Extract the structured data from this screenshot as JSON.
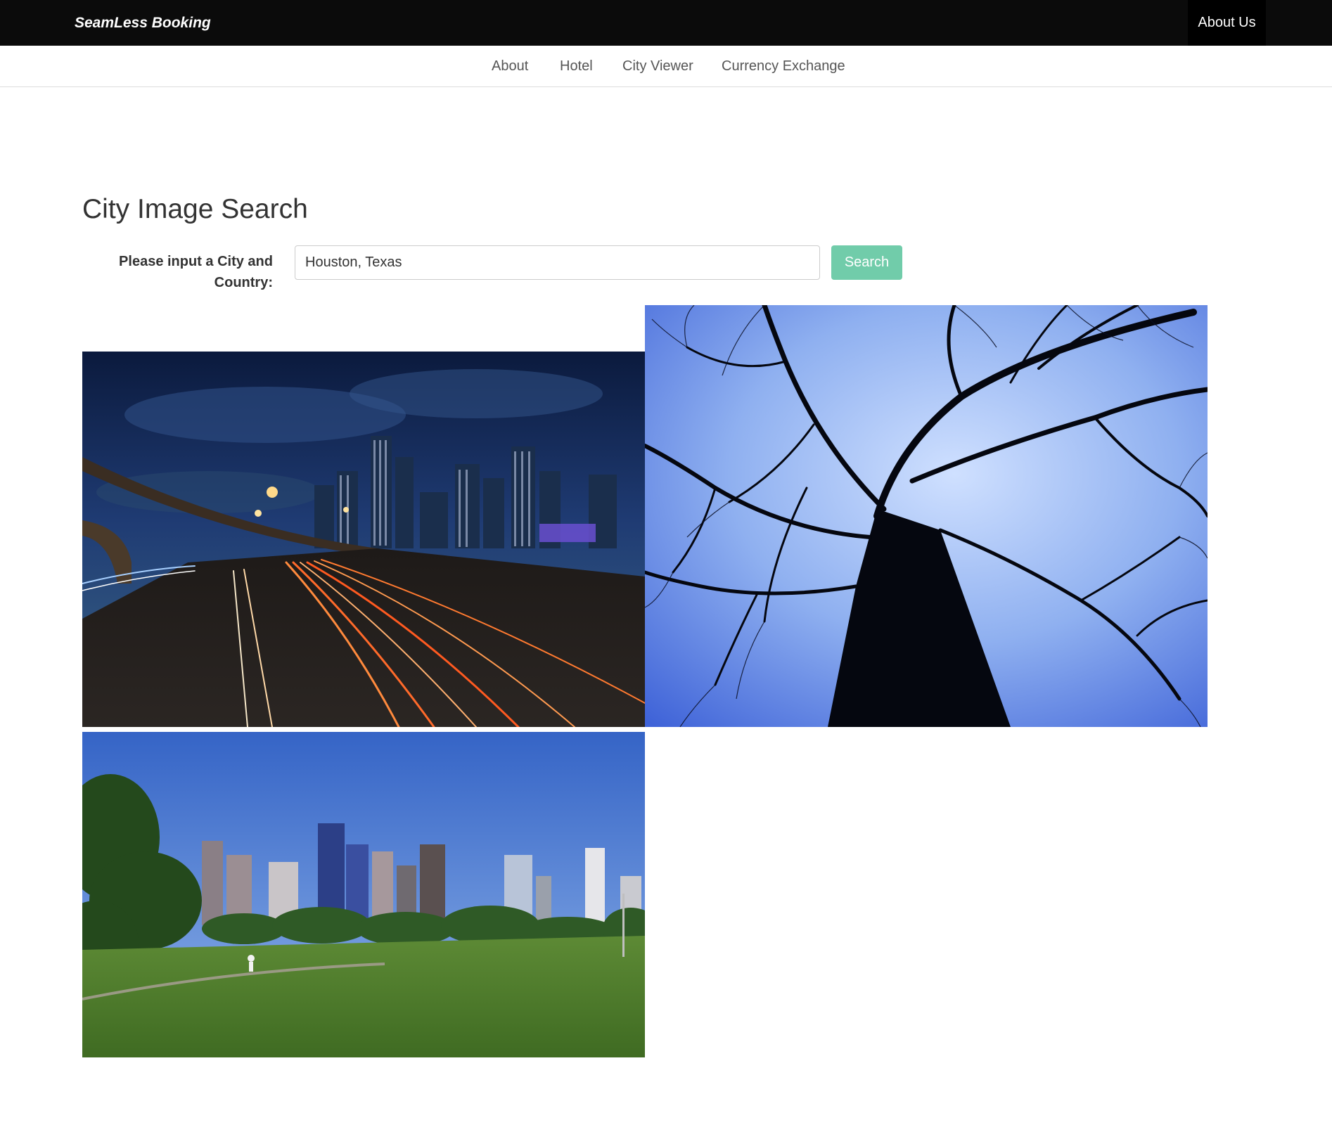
{
  "header": {
    "brand": "SeamLess Booking",
    "about_us": "About Us"
  },
  "subnav": {
    "items": [
      {
        "label": "About"
      },
      {
        "label": "Hotel"
      },
      {
        "label": "City Viewer"
      },
      {
        "label": "Currency Exchange"
      }
    ]
  },
  "main": {
    "title": "City Image Search",
    "input_label": "Please input a City and Country:",
    "input_value": "Houston, Texas",
    "search_label": "Search"
  },
  "results": {
    "images": [
      {
        "subject": "night-highway-skyline-image"
      },
      {
        "subject": "bare-tree-silhouette-image"
      },
      {
        "subject": "daytime-park-skyline-image"
      }
    ]
  },
  "colors": {
    "topbar": "#0b0b0b",
    "search_button": "#71ccaa",
    "text": "#333333"
  }
}
